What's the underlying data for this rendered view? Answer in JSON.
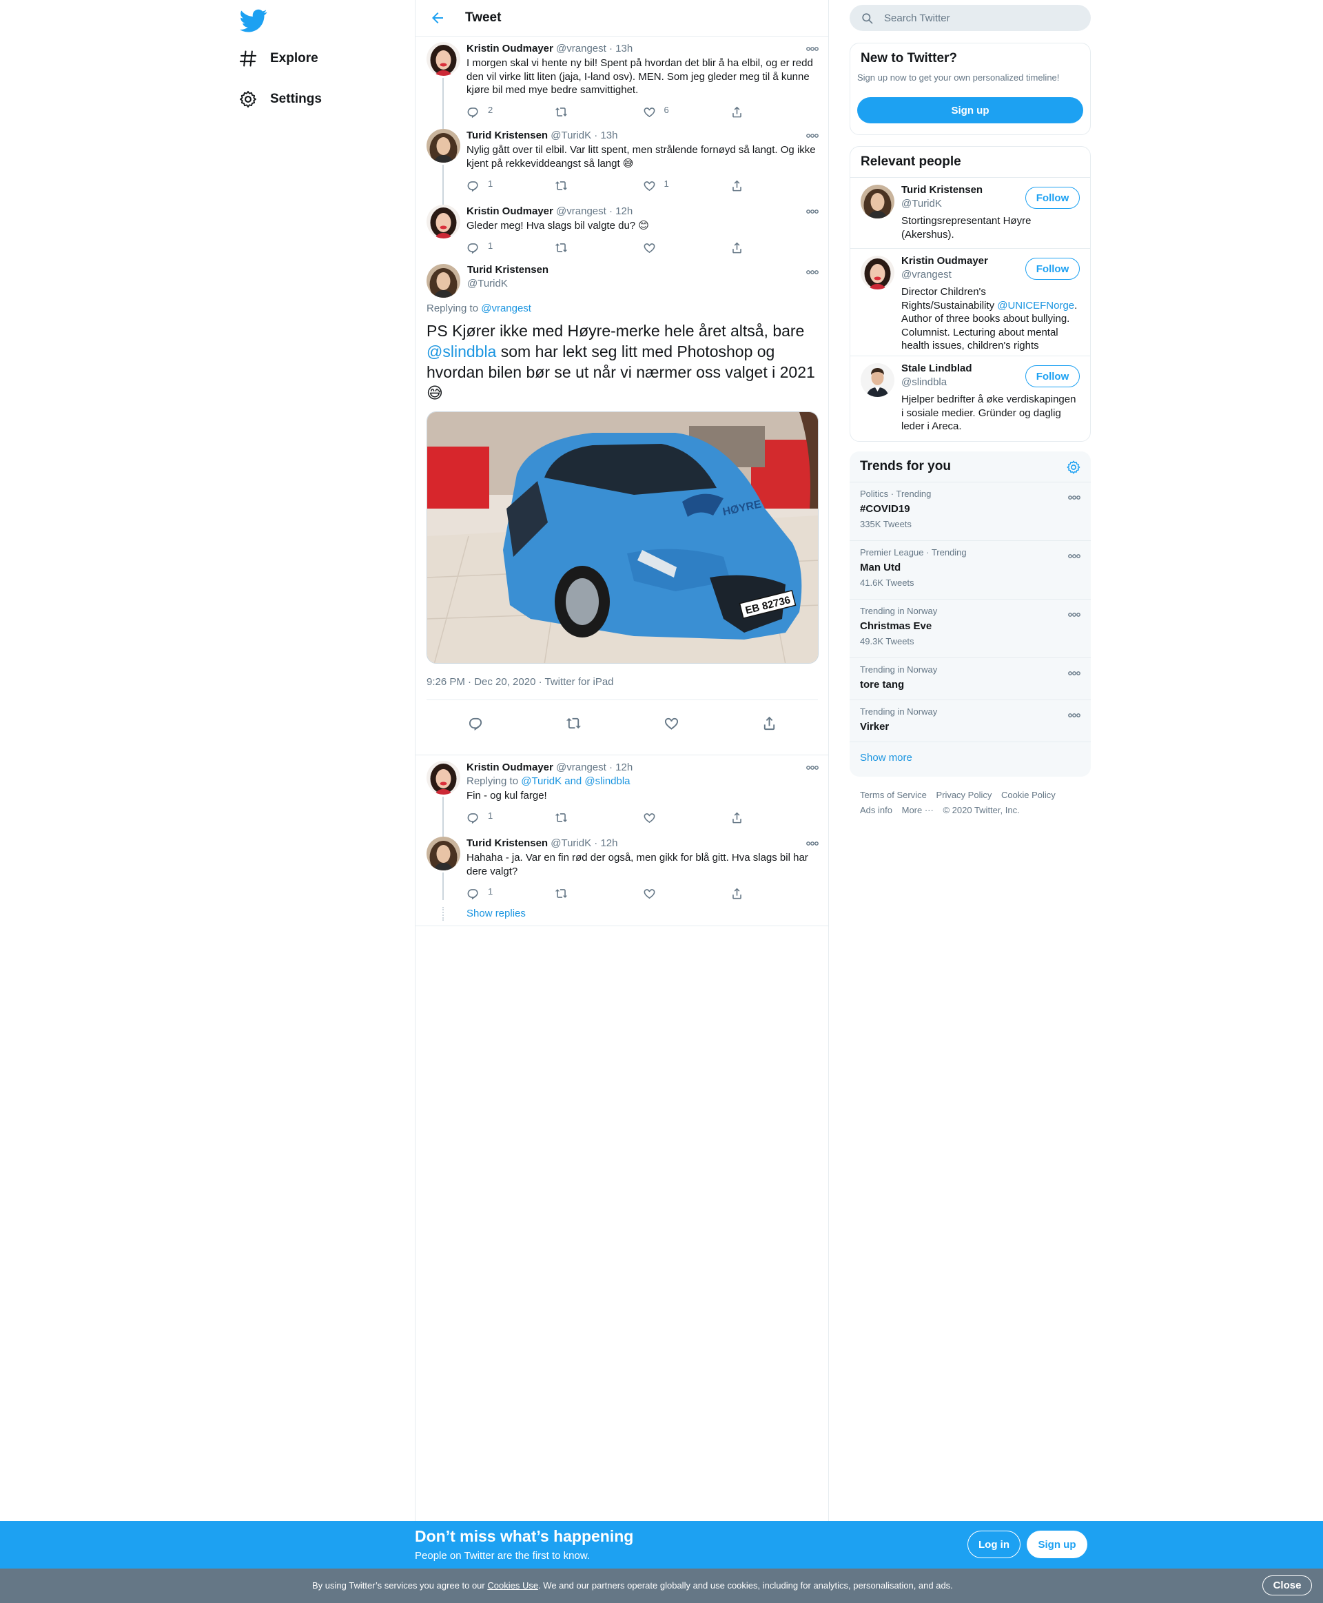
{
  "nav": {
    "explore_label": "Explore",
    "settings_label": "Settings"
  },
  "header": {
    "title": "Tweet"
  },
  "thread_above": [
    {
      "name": "Kristin Oudmayer",
      "handle": "@vrangest",
      "time": "13h",
      "text": "I morgen skal vi hente ny bil! Spent på hvordan det blir å ha elbil, og er redd den vil virke litt liten (jaja, I-land osv). MEN. Som jeg gleder meg til å kunne kjøre bil med mye bedre samvittighet.",
      "replies": "2",
      "retweets": "",
      "likes": "6"
    },
    {
      "name": "Turid Kristensen",
      "handle": "@TuridK",
      "time": "13h",
      "text": "Nylig gått over til elbil. Var litt spent, men strålende fornøyd så langt. Og ikke kjent på rekkeviddeangst så langt 😅",
      "replies": "1",
      "retweets": "",
      "likes": "1"
    },
    {
      "name": "Kristin Oudmayer",
      "handle": "@vrangest",
      "time": "12h",
      "text": "Gleder meg! Hva slags bil valgte du? 😊",
      "replies": "1",
      "retweets": "",
      "likes": ""
    }
  ],
  "focus": {
    "name": "Turid Kristensen",
    "handle": "@TuridK",
    "replying_prefix": "Replying to",
    "replying_to": "@vrangest",
    "text_a": "PS Kjører ikke med Høyre-merke hele året altså, bare ",
    "mention": "@slindbla",
    "text_b": " som har lekt seg litt med Photoshop og hvordan bilen bør se ut når vi nærmer oss valget i 2021 😅",
    "photo_badge": "HØYRE",
    "photo_plate": "EB 82736",
    "timestamp": "9:26 PM · Dec 20, 2020 · Twitter for iPad"
  },
  "thread_below": [
    {
      "name": "Kristin Oudmayer",
      "handle": "@vrangest",
      "time": "12h",
      "replying_prefix": "Replying to",
      "replying_to": "@TuridK and @slindbla",
      "text": "Fin - og kul farge!",
      "replies": "1",
      "retweets": "",
      "likes": ""
    },
    {
      "name": "Turid Kristensen",
      "handle": "@TuridK",
      "time": "12h",
      "text": "Hahaha - ja. Var en fin rød der også, men gikk for blå gitt. Hva slags bil har dere valgt?",
      "replies": "1",
      "retweets": "",
      "likes": ""
    }
  ],
  "show_replies": "Show replies",
  "search": {
    "placeholder": "Search Twitter"
  },
  "signup_card": {
    "title": "New to Twitter?",
    "subtitle": "Sign up now to get your own personalized timeline!",
    "button": "Sign up"
  },
  "relevant": {
    "title": "Relevant people",
    "follow_label": "Follow",
    "people": [
      {
        "name": "Turid Kristensen",
        "handle": "@TuridK",
        "bio": "Stortingsrepresentant Høyre (Akershus)."
      },
      {
        "name": "Kristin Oudmayer",
        "handle": "@vrangest",
        "bio_a": "Director Children's Rights/Sustainability ",
        "bio_link": "@UNICEFNorge",
        "bio_b": ". Author of three books about bullying. Columnist. Lecturing about mental health issues, children's rights"
      },
      {
        "name": "Stale Lindblad",
        "handle": "@slindbla",
        "bio": "Hjelper bedrifter å øke verdiskapingen i sosiale medier. Gründer og daglig leder i Areca."
      }
    ]
  },
  "trends": {
    "title": "Trends for you",
    "items": [
      {
        "meta": "Politics · Trending",
        "name": "#COVID19",
        "count": "335K Tweets"
      },
      {
        "meta": "Premier League · Trending",
        "name": "Man Utd",
        "count": "41.6K Tweets"
      },
      {
        "meta": "Trending in Norway",
        "name": "Christmas Eve",
        "count": "49.3K Tweets"
      },
      {
        "meta": "Trending in Norway",
        "name": "tore tang",
        "count": ""
      },
      {
        "meta": "Trending in Norway",
        "name": "Virker",
        "count": ""
      }
    ],
    "show_more": "Show more"
  },
  "footer": {
    "terms": "Terms of Service",
    "privacy": "Privacy Policy",
    "cookie": "Cookie Policy",
    "ads": "Ads info",
    "more": "More ···",
    "copyright": "© 2020 Twitter, Inc."
  },
  "bottom_bar": {
    "title": "Don’t miss what’s happening",
    "subtitle": "People on Twitter are the first to know.",
    "login": "Log in",
    "signup": "Sign up"
  },
  "cookie_bar": {
    "text_a": "By using Twitter’s services you agree to our ",
    "link": "Cookies Use",
    "text_b": ". We and our partners operate globally and use cookies, including for analytics, personalisation, and ads.",
    "close": "Close"
  },
  "colors": {
    "accent": "#1da1f2",
    "link": "#1b95e0",
    "muted": "#657786",
    "border": "#e6ecf0",
    "car_blue": "#3a8fd3"
  }
}
